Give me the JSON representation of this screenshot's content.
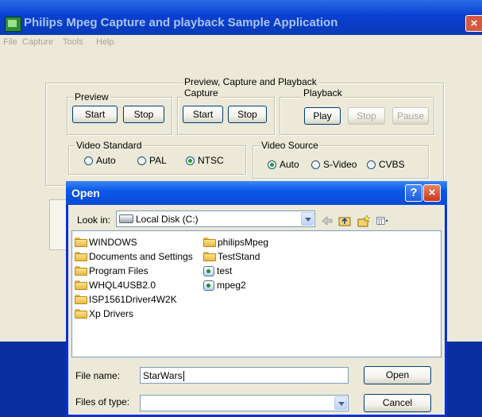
{
  "main_window": {
    "title": "Philips Mpeg Capture and playback Sample Application",
    "menu": [
      "File",
      "Capture",
      "Tools",
      "Help"
    ]
  },
  "controls": {
    "group_title": "Preview, Capture and Playback",
    "preview": {
      "label": "Preview",
      "start": "Start",
      "stop": "Stop"
    },
    "capture": {
      "label": "Capture",
      "start": "Start",
      "stop": "Stop"
    },
    "playback": {
      "label": "Playback",
      "play": "Play",
      "stop": "Stop",
      "pause": "Pause"
    },
    "video_standard": {
      "label": "Video Standard",
      "options": [
        "Auto",
        "PAL",
        "NTSC"
      ],
      "selected": "NTSC"
    },
    "video_source": {
      "label": "Video Source",
      "options": [
        "Auto",
        "S-Video",
        "CVBS"
      ],
      "selected": "Auto"
    }
  },
  "open_dialog": {
    "title": "Open",
    "look_in_label": "Look in:",
    "look_in_value": "Local Disk (C:)",
    "toolbar_icons": [
      "back-arrow-icon",
      "up-folder-icon",
      "new-folder-icon",
      "view-menu-icon"
    ],
    "files": [
      {
        "name": "WINDOWS",
        "type": "folder"
      },
      {
        "name": "Documents and Settings",
        "type": "folder"
      },
      {
        "name": "Program Files",
        "type": "folder"
      },
      {
        "name": "WHQL4USB2.0",
        "type": "folder"
      },
      {
        "name": "ISP1561Driver4W2K",
        "type": "folder"
      },
      {
        "name": "Xp Drivers",
        "type": "folder"
      },
      {
        "name": "philipsMpeg",
        "type": "folder"
      },
      {
        "name": "TestStand",
        "type": "folder"
      },
      {
        "name": "test",
        "type": "file"
      },
      {
        "name": "mpeg2",
        "type": "file"
      }
    ],
    "file_name_label": "File name:",
    "file_name_value": "StarWars",
    "files_of_type_label": "Files of type:",
    "files_of_type_value": "",
    "open_button": "Open",
    "cancel_button": "Cancel"
  },
  "colors": {
    "title_blue": "#0a3fd1",
    "dialog_border": "#0831d9",
    "face": "#ece9d8"
  }
}
